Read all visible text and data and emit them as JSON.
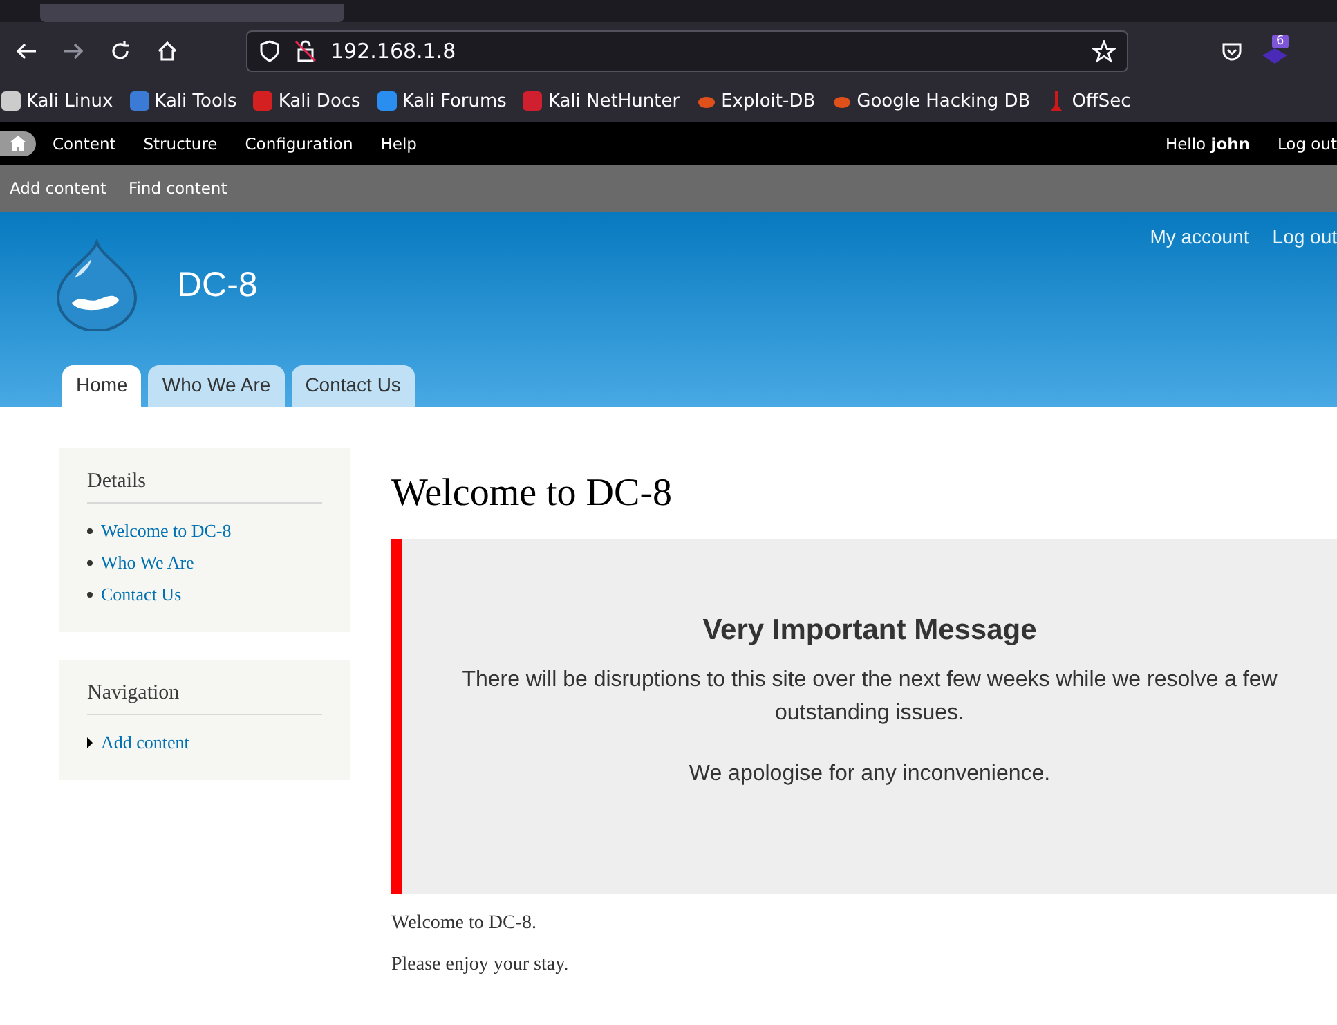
{
  "browser": {
    "url": "192.168.1.8",
    "badge": "6",
    "bookmarks": [
      {
        "label": "Kali Linux",
        "kind": "dragon"
      },
      {
        "label": "Kali Tools",
        "kind": "tools"
      },
      {
        "label": "Kali Docs",
        "kind": "docs"
      },
      {
        "label": "Kali Forums",
        "kind": "forums"
      },
      {
        "label": "Kali NetHunter",
        "kind": "nethunter"
      },
      {
        "label": "Exploit-DB",
        "kind": "bug"
      },
      {
        "label": "Google Hacking DB",
        "kind": "bug"
      },
      {
        "label": "OffSec",
        "kind": "offsec"
      }
    ]
  },
  "admin_toolbar": {
    "menu": [
      "Content",
      "Structure",
      "Configuration",
      "Help"
    ],
    "greeting": "Hello **john**",
    "logout": "Log out"
  },
  "shortcuts": [
    "Add content",
    "Find content"
  ],
  "site": {
    "name": "DC-8",
    "secondary_links": [
      "My account",
      "Log out"
    ],
    "tabs": [
      {
        "label": "Home",
        "selected": true
      },
      {
        "label": "Who We Are",
        "selected": false
      },
      {
        "label": "Contact Us",
        "selected": false
      }
    ]
  },
  "sidebar": [
    {
      "title": "Details",
      "kind": "bullets",
      "links": [
        "Welcome to DC-8",
        "Who We Are",
        "Contact Us"
      ]
    },
    {
      "title": "Navigation",
      "kind": "arrows",
      "links": [
        "Add content"
      ]
    }
  ],
  "content": {
    "title": "Welcome to DC-8",
    "notice": {
      "heading": "Very Important Message",
      "paragraphs": [
        "There will be disruptions to this site over the next few weeks while we resolve a few outstanding issues.",
        "We apologise for any inconvenience."
      ]
    },
    "paragraphs": [
      "Welcome to DC-8.",
      "Please enjoy your stay."
    ]
  }
}
